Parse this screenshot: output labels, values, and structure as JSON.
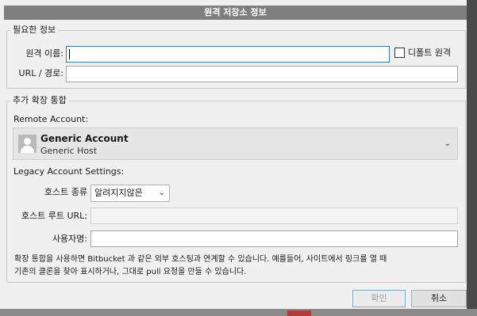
{
  "dialog": {
    "title": "원격 저장소 정보"
  },
  "required": {
    "legend": "필요한 정보",
    "remote_name_label": "원격 이름:",
    "remote_name_value": "",
    "default_remote_label": "디폴트 원격",
    "default_remote_checked": false,
    "url_label": "URL / 경로:",
    "url_value": ""
  },
  "integration": {
    "legend": "추가 확장 통합",
    "remote_account_label": "Remote Account:",
    "account_name": "Generic Account",
    "account_host": "Generic Host",
    "legacy_label": "Legacy Account Settings:",
    "host_type_label": "호스트 종류",
    "host_type_value": "알려지지않은",
    "host_root_label": "호스트 루트 URL:",
    "host_root_value": "",
    "username_label": "사용자명:",
    "username_value": "",
    "description_line1": "확장 통합을 사용하면 Bitbucket 과 같은 외부 호스팅과 연계할 수 있습니다. 예를들어, 사이트에서 링크를 열 때",
    "description_line2": "기존의 클론을 찾아 표시하거나, 그대로 pull 요청을 만들 수 있습니다."
  },
  "buttons": {
    "ok": "확인",
    "cancel": "취소",
    "ok_enabled": false
  },
  "colors": {
    "titlebar": "#7f7f7f",
    "focus": "#3c7fb1",
    "dialog_bg": "#f0f0f0"
  }
}
